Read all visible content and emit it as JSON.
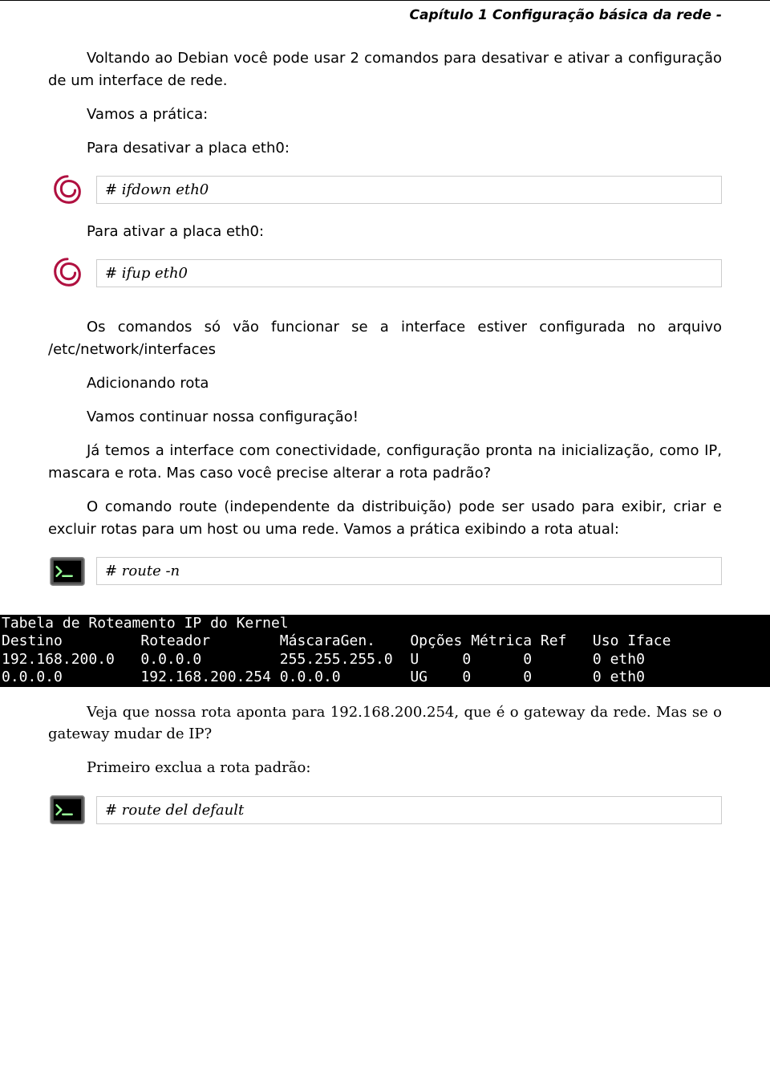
{
  "header": {
    "chapter_title": "Capítulo 1 Configuração básica da rede -"
  },
  "body": {
    "p1": "Voltando ao Debian você pode usar 2 comandos para desativar e ativar a configuração de um interface de rede.",
    "p2": "Vamos a prática:",
    "p3": "Para desativar a placa eth0:",
    "cmd1": "# ifdown eth0",
    "p4": "Para ativar a placa eth0:",
    "cmd2": "# ifup eth0",
    "p5": "Os comandos só vão funcionar se a interface estiver configurada no arquivo /etc/network/interfaces",
    "p6": "Adicionando rota",
    "p7": "Vamos continuar nossa configuração!",
    "p8": "Já temos a interface com conectividade, configuração pronta na inicialização, como IP, mascara e rota. Mas caso você precise alterar a rota padrão?",
    "p9": "O comando route (independente da distribuição) pode ser usado para exibir, criar e excluir rotas para um host ou uma rede. Vamos a prática exibindo a rota atual:",
    "cmd3": "# route -n",
    "terminal": "Tabela de Roteamento IP do Kernel\nDestino         Roteador        MáscaraGen.    Opções Métrica Ref   Uso Iface\n192.168.200.0   0.0.0.0         255.255.255.0  U     0      0       0 eth0\n0.0.0.0         192.168.200.254 0.0.0.0        UG    0      0       0 eth0",
    "p10": "Veja que nossa rota aponta para 192.168.200.254, que é o gateway da rede. Mas se o gateway mudar de IP?",
    "p11": "Primeiro exclua a rota padrão:",
    "cmd4": "# route del default"
  }
}
